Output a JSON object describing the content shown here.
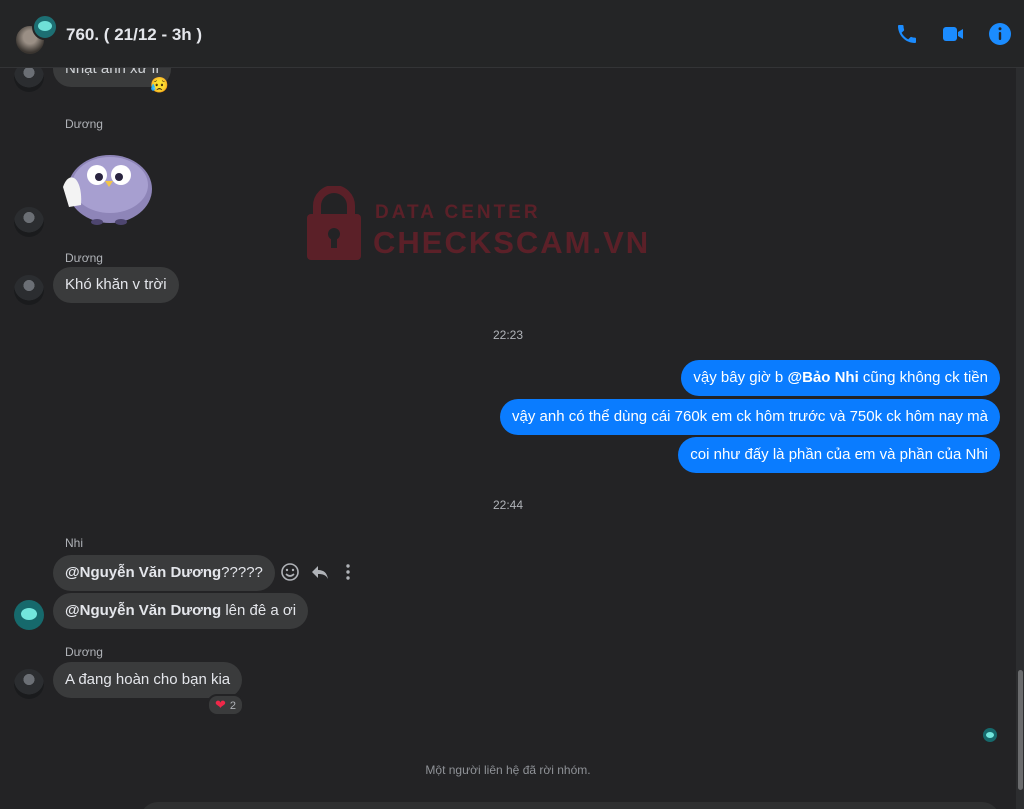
{
  "header": {
    "title": "760. ( 21/12 - 3h )",
    "icons": [
      "phone-icon",
      "video-icon",
      "info-icon"
    ],
    "accent": "#1b8cff"
  },
  "watermark": {
    "small": "DATA CENTER",
    "big": "CHECKSCAM.VN"
  },
  "messages": {
    "top_partial_text": "Nhật anh xử lí",
    "top_reaction": "😥",
    "sender_duong_1": "Dương",
    "sender_duong_2": "Dương",
    "msg_kho_khan": "Khó khăn v trời",
    "time_1": "22:23",
    "out_1_pre": "vậy bây giờ b ",
    "out_1_mention": "@Bảo Nhi",
    "out_1_post": " cũng không ck tiền",
    "out_2": "vậy anh có thể dùng cái 760k em ck hôm trước và 750k ck hôm nay mà",
    "out_3": "coi như đấy là phần của em và phần của Nhi",
    "time_2": "22:44",
    "sender_nhi": "Nhi",
    "nhi_1_mention": "@Nguyễn Văn Dương",
    "nhi_1_post": "?????",
    "nhi_2_mention": "@Nguyễn Văn Dương",
    "nhi_2_post": " lên đê a ơi",
    "sender_duong_3": "Dương",
    "duong_last": "A đang hoàn cho bạn kia",
    "reaction_heart": "❤",
    "reaction_count": "2",
    "system_note": "Một người liên hệ đã rời nhóm."
  },
  "colors": {
    "outgoing": "#0a7cff",
    "incoming": "#3a3b3c",
    "background": "#232325"
  }
}
